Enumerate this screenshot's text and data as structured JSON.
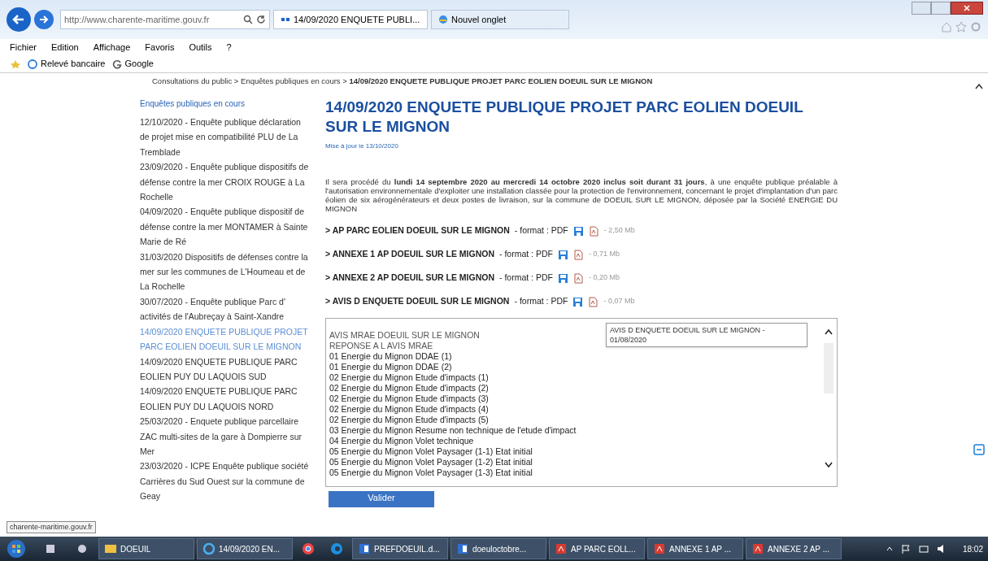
{
  "browser": {
    "address": "http://www.charente-maritime.gouv.fr",
    "tabs": [
      {
        "label": "14/09/2020 ENQUETE PUBLI...",
        "selected": true
      },
      {
        "label": "Nouvel onglet",
        "selected": false
      }
    ],
    "menu": [
      "Fichier",
      "Edition",
      "Affichage",
      "Favoris",
      "Outils",
      "?"
    ],
    "favorites": [
      {
        "kind": "ie",
        "label": "Relevé bancaire"
      },
      {
        "kind": "google",
        "label": "Google"
      }
    ]
  },
  "breadcrumb": {
    "links": [
      "Consultations du public",
      "Enquêtes publiques en cours"
    ],
    "separator": ">",
    "current": "14/09/2020 ENQUETE PUBLIQUE PROJET PARC EOLIEN DOEUIL SUR LE MIGNON"
  },
  "sidebar": {
    "title": "Enquêtes publiques en cours",
    "items": [
      {
        "label": "12/10/2020 - Enquête publique déclaration de projet mise en compatibilité PLU de La Tremblade",
        "selected": false
      },
      {
        "label": "23/09/2020 - Enquête publique dispositifs de défense contre la mer CROIX ROUGE à La Rochelle",
        "selected": false
      },
      {
        "label": "04/09/2020 - Enquête publique dispositif de défense contre la mer MONTAMER à Sainte Marie de Ré",
        "selected": false
      },
      {
        "label": "31/03/2020 Dispositifs de défenses contre la mer sur les communes de L'Houmeau et de La Rochelle",
        "selected": false
      },
      {
        "label": "30/07/2020 - Enquête publique Parc d' activités de l'Aubreçay à Saint-Xandre",
        "selected": false
      },
      {
        "label": "14/09/2020 ENQUETE PUBLIQUE PROJET PARC EOLIEN DOEUIL SUR LE MIGNON",
        "selected": true
      },
      {
        "label": "14/09/2020 ENQUETE PUBLIQUE PARC EOLIEN PUY DU LAQUOIS SUD",
        "selected": false
      },
      {
        "label": "14/09/2020 ENQUETE PUBLIQUE PARC EOLIEN PUY DU LAQUOIS NORD",
        "selected": false
      },
      {
        "label": "25/03/2020 - Enquete publique parcellaire ZAC multi-sites de la gare à Dompierre sur Mer",
        "selected": false
      },
      {
        "label": "23/03/2020 - ICPE Enquête publique société Carrières du Sud Ouest sur la commune de Geay",
        "selected": false
      }
    ]
  },
  "article": {
    "title": "14/09/2020 ENQUETE PUBLIQUE PROJET PARC EOLIEN DOEUIL SUR LE MIGNON",
    "updated": "Mise à jour le 13/10/2020",
    "body": "Il sera procédé du **lundi 14 septembre 2020 au mercredi 14 octobre 2020 inclus soit durant 31 jours**, à une enquête publique préalable à l'autorisation environnementale d'exploiter une installation classée pour la protection de l'environnement, concernant le projet d'implantation d'un parc éolien de six aérogénérateurs et deux postes de livraison, sur la commune de DOEUIL SUR LE MIGNON, déposée par la Société ENERGIE DU MIGNON",
    "files": [
      {
        "name": "> AP PARC EOLIEN DOEUIL SUR LE MIGNON",
        "format": "- format : PDF",
        "size": "- 2,50 Mb"
      },
      {
        "name": "> ANNEXE 1 AP DOEUIL SUR LE MIGNON",
        "format": "- format : PDF",
        "size": "- 0,71 Mb"
      },
      {
        "name": "> ANNEXE 2 AP DOEUIL SUR LE MIGNON",
        "format": "- format : PDF",
        "size": "- 0,20 Mb"
      },
      {
        "name": "> AVIS D ENQUETE DOEUIL SUR LE MIGNON",
        "format": "- format : PDF",
        "size": "- 0,07 Mb"
      }
    ],
    "listbox": {
      "items": [
        "AVIS MRAE DOEUIL SUR LE MIGNON",
        "REPONSE A L AVIS MRAE",
        "01 Energie du Mignon DDAE (1)",
        "01 Energie du Mignon DDAE (2)",
        "02 Energie du Mignon Etude d'impacts (1)",
        "02 Energie du Mignon Etude d'impacts (2)",
        "02 Energie du Mignon Etude d'impacts (3)",
        "02 Energie du Mignon Etude d'impacts (4)",
        "02 Energie du Mignon Etude d'impacts (5)",
        "03 Energie du Mignon Resume non technique de l'etude d'impact",
        "04 Energie du Mignon Volet technique",
        "05 Energie du Mignon Volet Paysager (1-1) Etat initial",
        "05 Energie du Mignon Volet Paysager (1-2) Etat initial",
        "05 Energie du Mignon Volet Paysager (1-3) Etat initial"
      ],
      "tooltip": "AVIS D ENQUETE DOEUIL SUR LE MIGNON - 01/08/2020"
    },
    "submit": "Valider"
  },
  "status_url": "charente-maritime.gouv.fr",
  "taskbar": {
    "items": [
      {
        "kind": "folder",
        "label": "DOEUIL"
      },
      {
        "kind": "ie",
        "label": "14/09/2020 EN..."
      },
      {
        "kind": "chrome"
      },
      {
        "kind": "edge"
      },
      {
        "kind": "word",
        "label": "PREFDOEUIL.d..."
      },
      {
        "kind": "word",
        "label": "doeuloctobre..."
      },
      {
        "kind": "pdf",
        "label": "AP PARC EOLL..."
      },
      {
        "kind": "pdf",
        "label": "ANNEXE 1 AP ..."
      },
      {
        "kind": "pdf",
        "label": "ANNEXE 2 AP ..."
      }
    ],
    "clock": "18:02"
  }
}
